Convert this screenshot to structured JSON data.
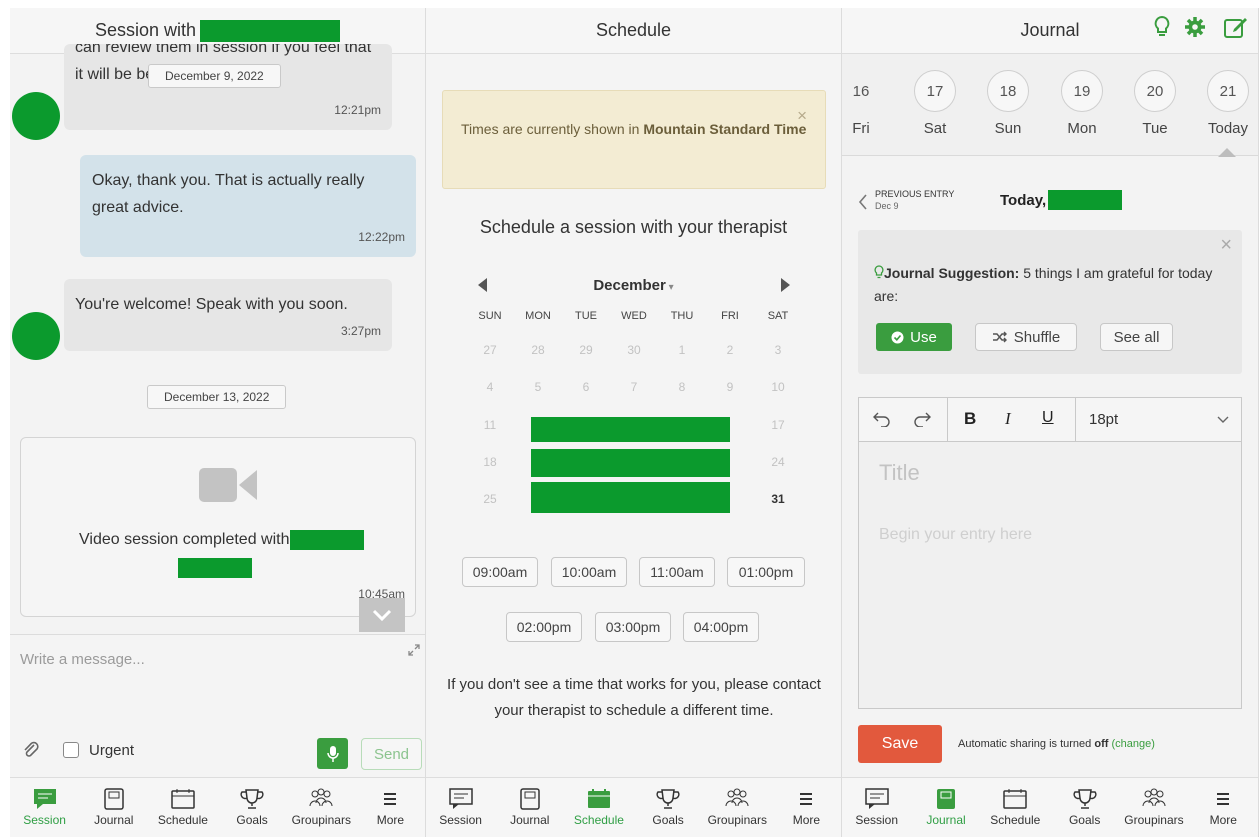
{
  "session": {
    "title": "Session with",
    "messages": [
      {
        "text": "can review them in session if you feel that it will be beneficial for you.",
        "time": "12:21pm"
      },
      {
        "text": "Okay, thank you. That is actually really great advice.",
        "time": "12:22pm"
      },
      {
        "text": "You're welcome! Speak with you soon.",
        "time": "3:27pm"
      }
    ],
    "date_top": "December 9, 2022",
    "date_mid": "December 13, 2022",
    "video_text": "Video session completed with",
    "video_time": "10:45am",
    "input_placeholder": "Write a message...",
    "urgent_label": "Urgent",
    "send_label": "Send"
  },
  "schedule": {
    "title": "Schedule",
    "notice_prefix": "Times are currently shown in ",
    "notice_bold": "Mountain Standard Time",
    "heading": "Schedule a session with your therapist",
    "month": "December",
    "weekdays": [
      "SUN",
      "MON",
      "TUE",
      "WED",
      "THU",
      "FRI",
      "SAT"
    ],
    "weeks": [
      [
        "27",
        "28",
        "29",
        "30",
        "1",
        "2",
        "3"
      ],
      [
        "4",
        "5",
        "6",
        "7",
        "8",
        "9",
        "10"
      ],
      [
        "11",
        "",
        "",
        "",
        "",
        "",
        "17"
      ],
      [
        "18",
        "",
        "",
        "",
        "",
        "",
        "24"
      ],
      [
        "25",
        "",
        "",
        "",
        "",
        "",
        "31"
      ]
    ],
    "slots": [
      "09:00am",
      "10:00am",
      "11:00am",
      "01:00pm",
      "02:00pm",
      "03:00pm",
      "04:00pm"
    ],
    "footer": "If you don't see a time that works for you, please contact your therapist to schedule a different time."
  },
  "journal": {
    "title": "Journal",
    "dates": [
      {
        "num": "16",
        "day": "Fri"
      },
      {
        "num": "17",
        "day": "Sat"
      },
      {
        "num": "18",
        "day": "Sun"
      },
      {
        "num": "19",
        "day": "Mon"
      },
      {
        "num": "20",
        "day": "Tue"
      },
      {
        "num": "21",
        "day": "Today"
      }
    ],
    "prev_entry": "PREVIOUS ENTRY",
    "prev_date": "Dec 9",
    "today_label": "Today,",
    "suggestion_label": "Journal Suggestion:",
    "suggestion_text": " 5 things I am grateful for today are:",
    "use_label": "Use",
    "shuffle_label": "Shuffle",
    "see_all_label": "See all",
    "font_size": "18pt",
    "title_placeholder": "Title",
    "body_placeholder": "Begin your entry here",
    "save_label": "Save",
    "sharing_prefix": "Automatic sharing is turned ",
    "sharing_bold": "off",
    "sharing_link": "(change)"
  },
  "tabs": [
    "Session",
    "Journal",
    "Schedule",
    "Goals",
    "Groupinars",
    "More"
  ],
  "colors": {
    "accent": "#3a9d3f",
    "redaction": "#0b9a2d",
    "save": "#e2593d"
  }
}
